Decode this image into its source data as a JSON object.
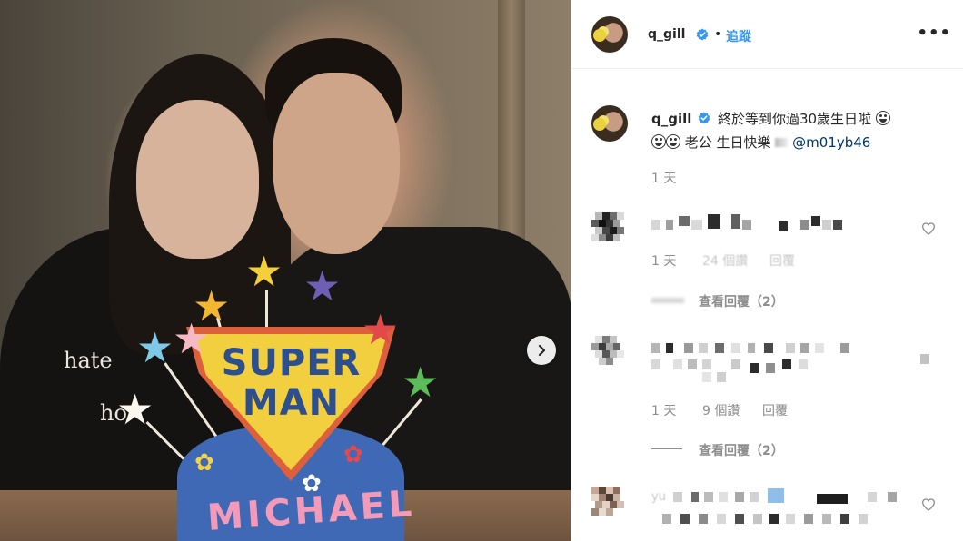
{
  "post": {
    "photo": {
      "shirt_text": [
        "hate",
        "ho"
      ],
      "cake_top": [
        "SUPER",
        "MAN"
      ],
      "cake_name": "MICHAEL",
      "next_icon": "chevron-right-icon"
    },
    "header": {
      "username": "q_gill",
      "separator": "•",
      "follow_label": "追蹤",
      "more_label": "•••",
      "verified_icon": "verified-badge-icon"
    },
    "caption": {
      "username": "q_gill",
      "text_line1": "終於等到你過30歲生日啦",
      "text_line2": "老公 生日快樂",
      "mention": "@m01yb46",
      "time": "1 天"
    },
    "comments": [
      {
        "time": "1 天",
        "likes": "24 個讚",
        "reply": "回覆",
        "view_replies": "查看回覆（2）"
      },
      {
        "time": "1 天",
        "likes": "9 個讚",
        "reply": "回覆",
        "view_replies": "查看回覆（2）"
      },
      {
        "partial_username": "yu"
      }
    ]
  },
  "colors": {
    "accent": "#3897f0",
    "text": "#262626",
    "muted": "#8e8e8e",
    "border": "#efefef"
  }
}
